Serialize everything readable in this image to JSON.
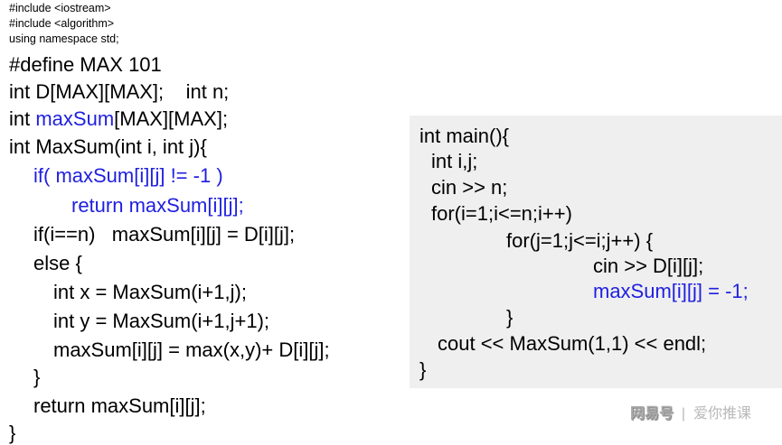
{
  "headers": [
    "#include <iostream>",
    "#include <algorithm>",
    "using namespace std;"
  ],
  "left_code": [
    {
      "text": "#define MAX 101",
      "blue": false
    },
    {
      "text": "int D[MAX][MAX];    int n;",
      "blue": false
    },
    {
      "pre": "int ",
      "text": "maxSum",
      "post": "[MAX][MAX];"
    },
    {
      "text": "int MaxSum(int i, int j){",
      "blue": false
    },
    {
      "text": "if( maxSum[i][j] != -1 )",
      "blue": true
    },
    {
      "text": "return maxSum[i][j];",
      "blue": true
    },
    {
      "text": "if(i==n)   maxSum[i][j] = D[i][j];",
      "blue": false
    },
    {
      "text": "else {",
      "blue": false
    },
    {
      "text": "int x = MaxSum(i+1,j);",
      "blue": false
    },
    {
      "text": "int y = MaxSum(i+1,j+1);",
      "blue": false
    },
    {
      "text": "maxSum[i][j] = max(x,y)+ D[i][j];",
      "blue": false
    },
    {
      "text": "}",
      "blue": false
    },
    {
      "text": "return maxSum[i][j];",
      "blue": false
    },
    {
      "text": "}",
      "blue": false
    }
  ],
  "right_code": [
    {
      "text": "int main(){"
    },
    {
      "text": "int i,j;"
    },
    {
      "text": "cin >> n;"
    },
    {
      "text": "for(i=1;i<=n;i++)"
    },
    {
      "text": "for(j=1;j<=i;j++) {"
    },
    {
      "text": "cin >> D[i][j];"
    },
    {
      "text": "maxSum[i][j] = -1;",
      "blue": true
    },
    {
      "text": "}"
    },
    {
      "text": "cout << MaxSum(1,1) << endl;"
    },
    {
      "text": "}"
    }
  ],
  "watermark": {
    "brand": "网易号",
    "sep": "|",
    "author": "爱你推课"
  },
  "colors": {
    "blue": "#1f1fe0",
    "box": "#efefef"
  }
}
